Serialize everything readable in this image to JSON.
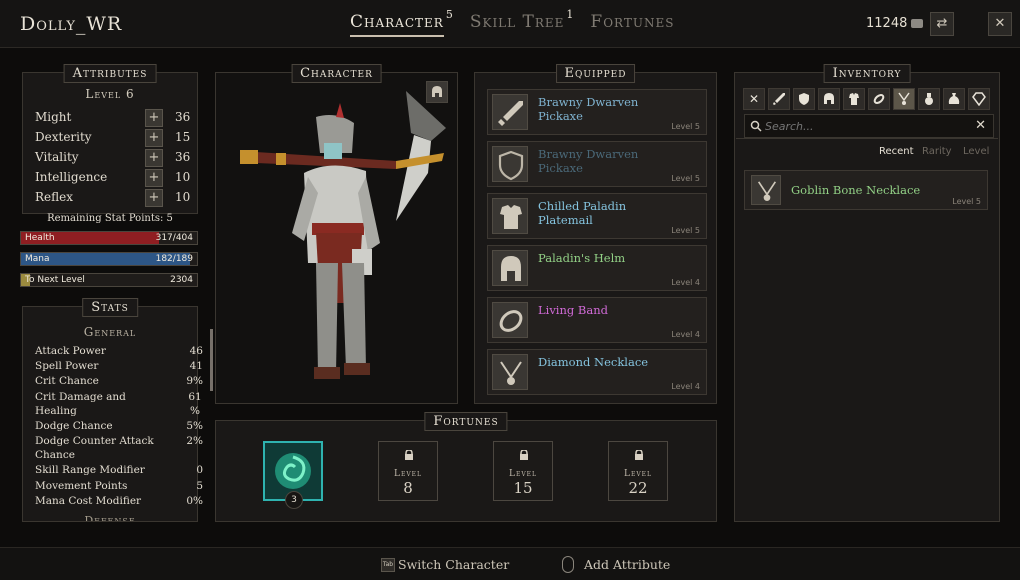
{
  "header": {
    "player_name": "Dolly_WR",
    "tabs": [
      {
        "label": "Character",
        "badge": "5"
      },
      {
        "label": "Skill Tree",
        "badge": "1"
      },
      {
        "label": "Fortunes",
        "badge": ""
      }
    ],
    "gold": "11248"
  },
  "attributes": {
    "title": "Attributes",
    "level": "Level 6",
    "items": [
      {
        "label": "Might",
        "value": "36"
      },
      {
        "label": "Dexterity",
        "value": "15"
      },
      {
        "label": "Vitality",
        "value": "36"
      },
      {
        "label": "Intelligence",
        "value": "10"
      },
      {
        "label": "Reflex",
        "value": "10"
      }
    ],
    "remaining": "Remaining Stat Points: 5"
  },
  "bars": {
    "health": {
      "label": "Health",
      "value": "317/404",
      "fraction": 0.785,
      "color": "#8f1e22"
    },
    "mana": {
      "label": "Mana",
      "value": "182/189",
      "fraction": 0.963,
      "color": "#2d5686"
    },
    "next_level": {
      "label": "To Next Level",
      "value": "2304",
      "fraction": 0.05,
      "color": "#9a8a3e"
    }
  },
  "stats": {
    "title": "Stats",
    "group_general": "General",
    "items": [
      {
        "label": "Attack Power",
        "value": "46"
      },
      {
        "label": "Spell Power",
        "value": "41"
      },
      {
        "label": "Crit Chance",
        "value": "9%"
      },
      {
        "label": "Crit Damage and Healing",
        "value": "61 %"
      },
      {
        "label": "Dodge Chance",
        "value": "5%"
      },
      {
        "label": "Dodge Counter Attack Chance",
        "value": "2%"
      },
      {
        "label": "Skill Range Modifier",
        "value": "0"
      },
      {
        "label": "Movement Points",
        "value": "5"
      },
      {
        "label": "Mana Cost Modifier",
        "value": "0%"
      }
    ],
    "group_defense": "Defense"
  },
  "character": {
    "title": "Character",
    "helm_toggle_icon": "helmet-icon"
  },
  "equipped": {
    "title": "Equipped",
    "slots": [
      {
        "name": "Brawny Dwarven Pickaxe",
        "level": "Level 5",
        "color": "#7fb2cf",
        "icon": "sword-icon"
      },
      {
        "name": "Brawny Dwarven Pickaxe",
        "level": "Level 5",
        "color": "#4a6878",
        "icon": "shield-icon"
      },
      {
        "name": "Chilled Paladin Platemail",
        "level": "Level 5",
        "color": "#85c4df",
        "icon": "armor-icon"
      },
      {
        "name": "Paladin's Helm",
        "level": "Level 4",
        "color": "#92d086",
        "icon": "helmet-icon"
      },
      {
        "name": "Living Band",
        "level": "Level 4",
        "color": "#d06ad6",
        "icon": "ring-icon"
      },
      {
        "name": "Diamond Necklace",
        "level": "Level 4",
        "color": "#85c4df",
        "icon": "necklace-icon"
      }
    ]
  },
  "inventory": {
    "title": "Inventory",
    "filters": [
      "clear-filter-icon",
      "sword-icon",
      "shield-icon",
      "helmet-icon",
      "armor-icon",
      "ring-icon",
      "necklace-icon",
      "potion-icon",
      "bag-icon",
      "gem-icon"
    ],
    "search_placeholder": "Search...",
    "sort": [
      "Recent",
      "Rarity",
      "Level"
    ],
    "items": [
      {
        "name": "Goblin Bone Necklace",
        "level": "Level 5",
        "color": "#92d086",
        "icon": "necklace-icon"
      }
    ]
  },
  "fortunes": {
    "title": "Fortunes",
    "active": {
      "count": "3",
      "icon": "swirl-orb-icon"
    },
    "locked": [
      {
        "label": "Level",
        "value": "8"
      },
      {
        "label": "Level",
        "value": "15"
      },
      {
        "label": "Level",
        "value": "22"
      }
    ]
  },
  "footer": {
    "switch_key": "Tab",
    "switch_label": "Switch Character",
    "add_label": "Add Attribute"
  }
}
